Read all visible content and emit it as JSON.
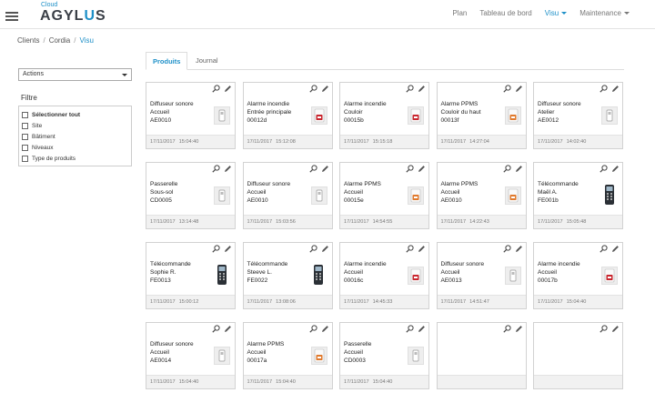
{
  "header": {
    "logo_small": "Cloud",
    "logo_pre": "AGYL",
    "logo_u": "U",
    "logo_post": "S",
    "nav": [
      {
        "label": "Plan",
        "active": false,
        "dropdown": false
      },
      {
        "label": "Tableau de bord",
        "active": false,
        "dropdown": false
      },
      {
        "label": "Visu",
        "active": true,
        "dropdown": true
      },
      {
        "label": "Maintenance",
        "active": false,
        "dropdown": true
      }
    ]
  },
  "breadcrumb": [
    "Clients",
    "Cordia",
    "Visu"
  ],
  "sidebar": {
    "actions_label": "Actions",
    "filter_title": "Filtre",
    "filters": [
      "Sélectionner tout",
      "Site",
      "Bâtiment",
      "Niveaux",
      "Type de produits"
    ]
  },
  "tabs": [
    "Produits",
    "Journal"
  ],
  "colors": {
    "accent": "#1e90c8",
    "alarm_red": "#c8262e",
    "ppms_orange": "#e07a2e"
  },
  "cards": [
    {
      "l1": "Diffuseur sonore",
      "l2": "Accueil",
      "l3": "AE0010",
      "date": "17/11/2017",
      "time": "15:04:40",
      "icon": "diffuser-icon"
    },
    {
      "l1": "Alarme incendie",
      "l2": "Entrée principale",
      "l3": "00012d",
      "date": "17/11/2017",
      "time": "15:12:08",
      "icon": "fire-alarm-icon"
    },
    {
      "l1": "Alarme incendie",
      "l2": "Couloir",
      "l3": "00015b",
      "date": "17/11/2017",
      "time": "15:15:18",
      "icon": "fire-alarm-icon"
    },
    {
      "l1": "Alarme PPMS",
      "l2": "Couloir du haut",
      "l3": "00013f",
      "date": "17/11/2017",
      "time": "14:27:04",
      "icon": "ppms-alarm-icon"
    },
    {
      "l1": "Diffuseur sonore",
      "l2": "Atelier",
      "l3": "AE0012",
      "date": "17/11/2017",
      "time": "14:02:40",
      "icon": "diffuser-icon"
    },
    {
      "l1": "Passerelle",
      "l2": "Sous-sol",
      "l3": "CD0005",
      "date": "17/11/2017",
      "time": "13:14:48",
      "icon": "diffuser-icon"
    },
    {
      "l1": "Diffuseur sonore",
      "l2": "Accueil",
      "l3": "AE0010",
      "date": "17/11/2017",
      "time": "15:03:56",
      "icon": "diffuser-icon"
    },
    {
      "l1": "Alarme PPMS",
      "l2": "Accueil",
      "l3": "00015e",
      "date": "17/11/2017",
      "time": "14:54:55",
      "icon": "ppms-alarm-icon"
    },
    {
      "l1": "Alarme PPMS",
      "l2": "Accueil",
      "l3": "AE0010",
      "date": "17/11/2017",
      "time": "14:22:43",
      "icon": "ppms-alarm-icon"
    },
    {
      "l1": "Télécommande",
      "l2": "Maël A.",
      "l3": "FE001b",
      "date": "17/11/2017",
      "time": "15:05:48",
      "icon": "remote-control-icon"
    },
    {
      "l1": "Télécommande",
      "l2": "Sophie R.",
      "l3": "FE0013",
      "date": "17/11/2017",
      "time": "15:00:12",
      "icon": "remote-control-icon"
    },
    {
      "l1": "Télécommande",
      "l2": "Steeve L.",
      "l3": "FE0022",
      "date": "17/11/2017",
      "time": "13:08:06",
      "icon": "remote-control-icon"
    },
    {
      "l1": "Alarme incendie",
      "l2": "Accueil",
      "l3": "00016c",
      "date": "17/11/2017",
      "time": "14:45:33",
      "icon": "fire-alarm-icon"
    },
    {
      "l1": "Diffuseur sonore",
      "l2": "Accueil",
      "l3": "AE0013",
      "date": "17/11/2017",
      "time": "14:51:47",
      "icon": "diffuser-icon"
    },
    {
      "l1": "Alarme incendie",
      "l2": "Accueil",
      "l3": "00017b",
      "date": "17/11/2017",
      "time": "15:04:40",
      "icon": "fire-alarm-icon"
    },
    {
      "l1": "Diffuseur sonore",
      "l2": "Accueil",
      "l3": "AE0014",
      "date": "17/11/2017",
      "time": "15:04:40",
      "icon": "diffuser-icon"
    },
    {
      "l1": "Alarme PPMS",
      "l2": "Accueil",
      "l3": "00017a",
      "date": "17/11/2017",
      "time": "15:04:40",
      "icon": "ppms-alarm-icon"
    },
    {
      "l1": "Passerelle",
      "l2": "Accueil",
      "l3": "CD0003",
      "date": "17/11/2017",
      "time": "15:04:40",
      "icon": "diffuser-icon"
    },
    {
      "l1": "",
      "l2": "",
      "l3": "",
      "date": "",
      "time": "",
      "icon": ""
    },
    {
      "l1": "",
      "l2": "",
      "l3": "",
      "date": "",
      "time": "",
      "icon": ""
    }
  ]
}
